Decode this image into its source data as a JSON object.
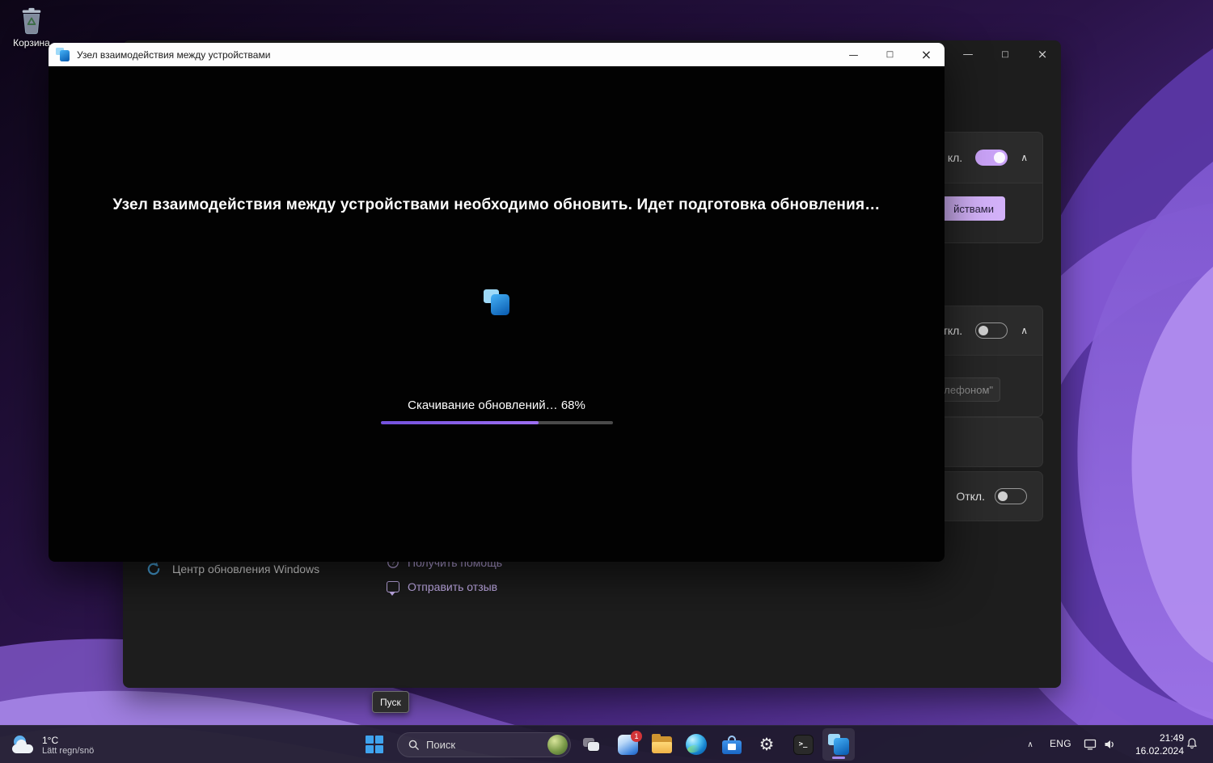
{
  "desktop": {
    "recycle_bin_label": "Корзина"
  },
  "dialog": {
    "title": "Узел взаимодействия между устройствами",
    "message": "Узел взаимодействия между устройствами необходимо обновить. Идет подготовка обновления…",
    "progress_text": "Скачивание обновлений… 68%",
    "progress_percent": 68
  },
  "settings_window": {
    "card1_toggle_label": "кл.",
    "purple_button_label": "йствами",
    "card2_toggle_label": "ткл.",
    "disabled_text": "лефоном\"",
    "card3_toggle_label": "Откл.",
    "toggles": {
      "card1": true,
      "card2": false,
      "card3": false
    },
    "footer": {
      "windows_update_label": "Центр обновления Windows",
      "get_help_label": "Получить помощь",
      "send_feedback_label": "Отправить отзыв"
    }
  },
  "tooltip": {
    "text": "Пуск"
  },
  "taskbar": {
    "weather": {
      "temperature": "1°C",
      "condition": "Lätt regn/snö"
    },
    "search": {
      "placeholder": "Поиск"
    },
    "badge_count": "1",
    "tray": {
      "language": "ENG",
      "time": "21:49",
      "date": "16.02.2024"
    }
  },
  "icons": {
    "minimize": "—",
    "maximize": "□",
    "close": "×",
    "chevron_up": "∧",
    "gear": "⚙",
    "terminal_prompt": ">_",
    "question_mark": "?"
  },
  "colors": {
    "accent": "#8b5cf6",
    "accent_light": "#d2b1f8"
  }
}
